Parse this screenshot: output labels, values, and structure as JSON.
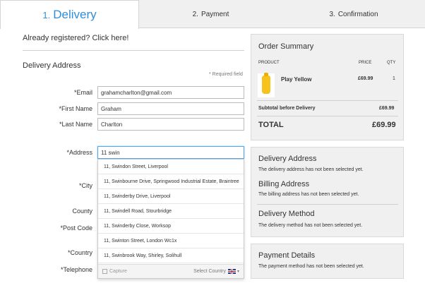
{
  "tabs": [
    {
      "num": "1.",
      "label": "Delivery",
      "active": true
    },
    {
      "num": "2.",
      "label": "Payment",
      "active": false
    },
    {
      "num": "3.",
      "label": "Confirmation",
      "active": false
    }
  ],
  "form": {
    "already_registered": "Already registered? Click here!",
    "section_title": "Delivery Address",
    "required_note": "* Required field",
    "email_label": "*Email",
    "email_value": "grahamcharlton@gmail.com",
    "first_name_label": "*First Name",
    "first_name_value": "Graham",
    "last_name_label": "*Last Name",
    "last_name_value": "Charlton",
    "address_label": "*Address",
    "address_value": "11 swin",
    "city_label": "*City",
    "county_label": "County",
    "postcode_label": "*Post Code",
    "country_label": "*Country",
    "telephone_label": "*Telephone"
  },
  "autocomplete": {
    "items": [
      "11, Swindon Street, Liverpool",
      "11, Swinbourne Drive, Springwood Industrial Estate, Braintree",
      "11, Swinderby Drive, Liverpool",
      "11, Swindell Road, Stourbridge",
      "11, Swinderby Close, Worksop",
      "11, Swinton Street, London Wc1x",
      "11, Swinbrook Way, Shirley, Solihull"
    ],
    "capture_label": "Capture",
    "select_country_label": "Select Country"
  },
  "order_summary": {
    "title": "Order Summary",
    "col_product": "PRODUCT",
    "col_price": "PRICE",
    "col_qty": "QTY",
    "product_name": "Play Yellow",
    "product_price": "£69.99",
    "product_qty": "1",
    "subtotal_label": "Subtotal before Delivery",
    "subtotal_value": "£69.99",
    "total_label": "TOTAL",
    "total_value": "£69.99"
  },
  "info": {
    "delivery_address_title": "Delivery Address",
    "delivery_address_text": "The delivery address has not been selected yet.",
    "billing_address_title": "Billing Address",
    "billing_address_text": "The billing address has not been selected yet.",
    "delivery_method_title": "Delivery Method",
    "delivery_method_text": "The delivery method has not been selected yet."
  },
  "payment": {
    "title": "Payment Details",
    "text": "The payment method has not been selected yet."
  },
  "colors": {
    "accent": "#2f8ed8",
    "panel_bg": "#f0f0f0",
    "product_yellow": "#f6c21b"
  }
}
